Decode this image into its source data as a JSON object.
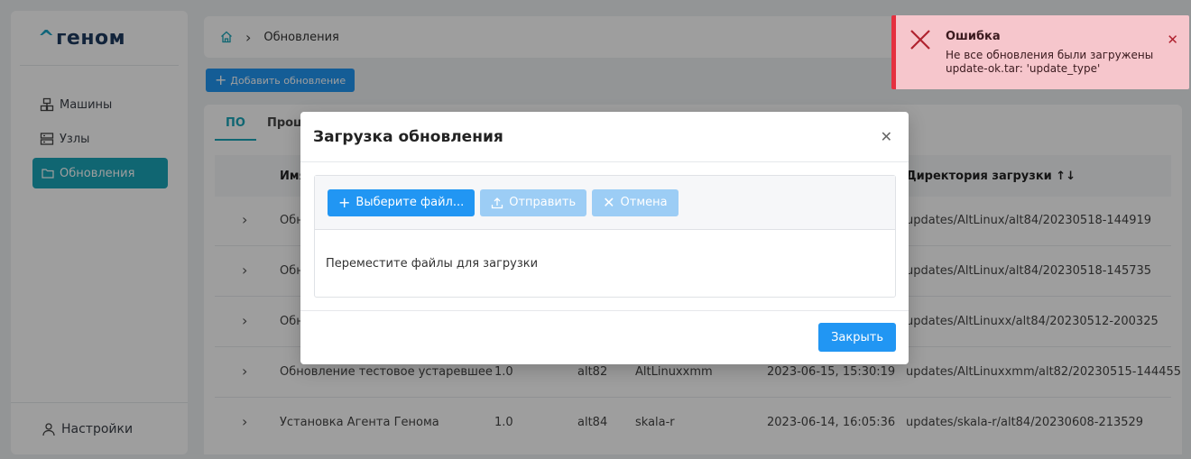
{
  "brand": {
    "caret": "^",
    "name": "геном"
  },
  "sidebar": {
    "items": [
      {
        "label": "Машины",
        "icon": "machines-icon"
      },
      {
        "label": "Узлы",
        "icon": "server-icon"
      },
      {
        "label": "Обновления",
        "icon": "folder-icon",
        "active": true
      }
    ],
    "settings_label": "Настройки"
  },
  "breadcrumb": {
    "current": "Обновления"
  },
  "toolbar": {
    "add_label": "Добавить обновление"
  },
  "tabs": [
    {
      "label": "ПО",
      "active": true
    },
    {
      "label": "Проши"
    }
  ],
  "table": {
    "headers": {
      "name": "Имя",
      "dir": "Директория загрузки ↑↓"
    },
    "rows": [
      {
        "name": "Обн",
        "version": "",
        "arch": "",
        "os": "",
        "date": "",
        "dir": "updates/AltLinux/alt84/20230518-144919"
      },
      {
        "name": "Обн",
        "version": "",
        "arch": "",
        "os": "",
        "date": "",
        "dir": "updates/AltLinux/alt84/20230518-145735"
      },
      {
        "name": "Обн",
        "version": "",
        "arch": "",
        "os": "",
        "date": "",
        "dir": "updates/AltLinuxx/alt84/20230512-200325"
      },
      {
        "name": "Обновление тестовое устаревшее",
        "version": "1.0",
        "arch": "alt82",
        "os": "AltLinuxxmm",
        "date": "2023-06-15, 15:30:19",
        "dir": "updates/AltLinuxxmm/alt82/20230515-144455"
      },
      {
        "name": "Установка Агента Генома",
        "version": "1.0",
        "arch": "alt84",
        "os": "skala-r",
        "date": "2023-06-14, 16:05:36",
        "dir": "updates/skala-r/alt84/20230608-213529"
      }
    ]
  },
  "modal": {
    "title": "Загрузка обновления",
    "choose_label": "Выберите файл...",
    "send_label": "Отправить",
    "cancel_label": "Отмена",
    "drop_text": "Переместите файлы для загрузки",
    "close_label": "Закрыть"
  },
  "toast": {
    "title": "Ошибка",
    "message": "Не все обновления были загружены update-ok.tar: 'update_type'",
    "color": "#e5303f"
  }
}
